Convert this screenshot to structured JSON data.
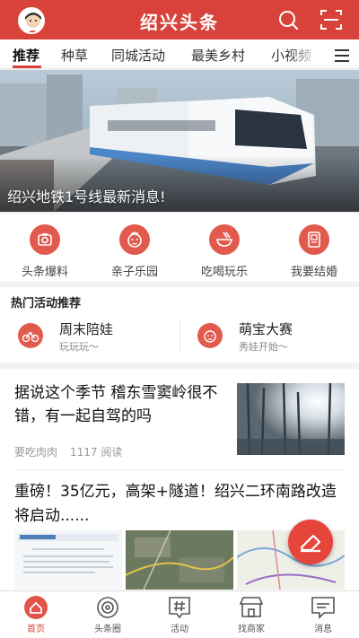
{
  "header": {
    "title": "绍兴头条",
    "search_icon": "search-icon",
    "scan_icon": "scan-icon",
    "accent": "#d9423a"
  },
  "tabs": [
    {
      "label": "推荐",
      "active": true
    },
    {
      "label": "种草"
    },
    {
      "label": "同城活动"
    },
    {
      "label": "最美乡村"
    },
    {
      "label": "小视频"
    }
  ],
  "banner": {
    "caption": "绍兴地铁1号线最新消息!"
  },
  "quick_links": [
    {
      "label": "头条爆料",
      "icon": "camera-icon"
    },
    {
      "label": "亲子乐园",
      "icon": "child-face-icon"
    },
    {
      "label": "吃喝玩乐",
      "icon": "food-bowl-icon"
    },
    {
      "label": "我要结婚",
      "icon": "certificate-icon"
    }
  ],
  "hot": {
    "title": "热门活动推荐",
    "items": [
      {
        "name": "周末陪娃",
        "sub": "玩玩玩～",
        "icon": "bike-icon"
      },
      {
        "name": "萌宝大赛",
        "sub": "秀娃开始～",
        "icon": "baby-face-icon"
      }
    ]
  },
  "news": [
    {
      "title": "据说这个季节 稽东雪窦岭很不错，有一起自驾的吗",
      "author": "要吃肉肉",
      "views": "1117 阅读"
    },
    {
      "title": "重磅！35亿元，高架+隧道！绍兴二环南路改造将启动......"
    }
  ],
  "bottom_nav": [
    {
      "label": "首页",
      "icon": "home-icon",
      "active": true
    },
    {
      "label": "头条圈",
      "icon": "circle-target-icon"
    },
    {
      "label": "活动",
      "icon": "hash-bubble-icon"
    },
    {
      "label": "找商家",
      "icon": "store-icon"
    },
    {
      "label": "消息",
      "icon": "message-icon"
    }
  ]
}
